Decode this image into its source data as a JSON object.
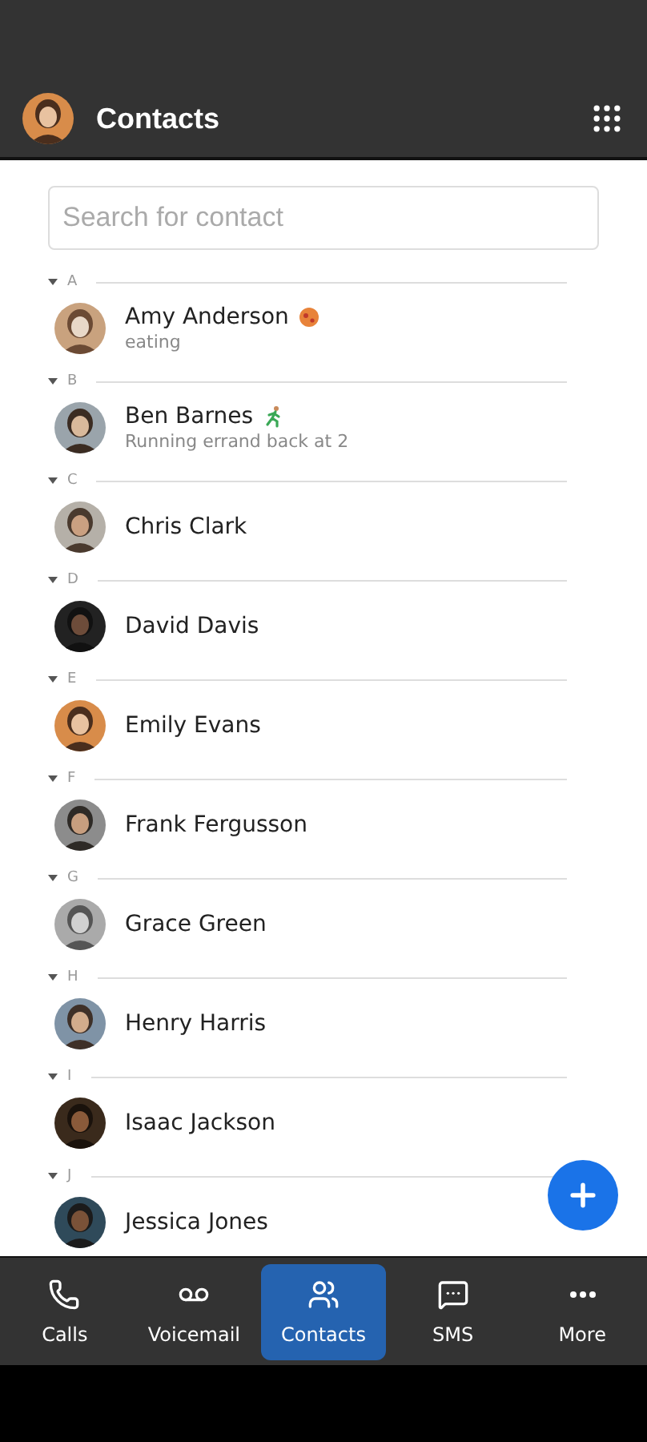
{
  "header": {
    "title": "Contacts"
  },
  "search": {
    "placeholder": "Search for contact"
  },
  "sections": [
    {
      "letter": "A",
      "contacts": [
        {
          "name": "Amy Anderson",
          "kind": "food",
          "status": "eating"
        }
      ]
    },
    {
      "letter": "B",
      "contacts": [
        {
          "name": "Ben Barnes",
          "kind": "running",
          "status": "Running errand back at 2"
        }
      ]
    },
    {
      "letter": "C",
      "contacts": [
        {
          "name": "Chris Clark"
        }
      ]
    },
    {
      "letter": "D",
      "contacts": [
        {
          "name": "David Davis"
        }
      ]
    },
    {
      "letter": "E",
      "contacts": [
        {
          "name": "Emily Evans"
        }
      ]
    },
    {
      "letter": "F",
      "contacts": [
        {
          "name": "Frank Fergusson"
        }
      ]
    },
    {
      "letter": "G",
      "contacts": [
        {
          "name": "Grace Green"
        }
      ]
    },
    {
      "letter": "H",
      "contacts": [
        {
          "name": "Henry Harris"
        }
      ]
    },
    {
      "letter": "I",
      "contacts": [
        {
          "name": "Isaac Jackson"
        }
      ]
    },
    {
      "letter": "J",
      "contacts": [
        {
          "name": "Jessica Jones"
        }
      ]
    }
  ],
  "nav": [
    {
      "label": "Calls",
      "selected": false
    },
    {
      "label": "Voicemail",
      "selected": false
    },
    {
      "label": "Contacts",
      "selected": true
    },
    {
      "label": "SMS",
      "selected": false
    },
    {
      "label": "More",
      "selected": false
    }
  ]
}
